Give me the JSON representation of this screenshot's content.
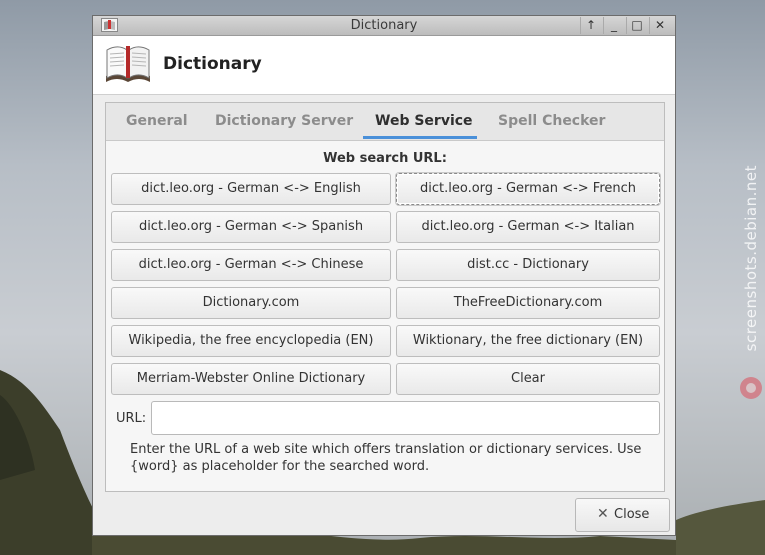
{
  "window": {
    "title": "Dictionary",
    "controls": [
      "↑",
      "_",
      "□",
      "✕"
    ]
  },
  "header": {
    "title": "Dictionary"
  },
  "tabs": [
    {
      "label": "General",
      "active": false
    },
    {
      "label": "Dictionary Server",
      "active": false
    },
    {
      "label": "Web Service",
      "active": true
    },
    {
      "label": "Spell Checker",
      "active": false
    }
  ],
  "web_service": {
    "section_title": "Web search URL:",
    "buttons": [
      "dict.leo.org - German <-> English",
      "dict.leo.org - German <-> French",
      "dict.leo.org - German <-> Spanish",
      "dict.leo.org - German <-> Italian",
      "dict.leo.org - German <-> Chinese",
      "dist.cc - Dictionary",
      "Dictionary.com",
      "TheFreeDictionary.com",
      "Wikipedia, the free encyclopedia (EN)",
      "Wiktionary, the free dictionary (EN)",
      "Merriam-Webster Online Dictionary",
      "Clear"
    ],
    "url_label": "URL:",
    "url_value": "",
    "help_text": "Enter the URL of a web site which offers translation or dictionary services. Use {word} as placeholder for the searched word."
  },
  "footer": {
    "close_label": "Close"
  },
  "watermark": "screenshots.debian.net"
}
